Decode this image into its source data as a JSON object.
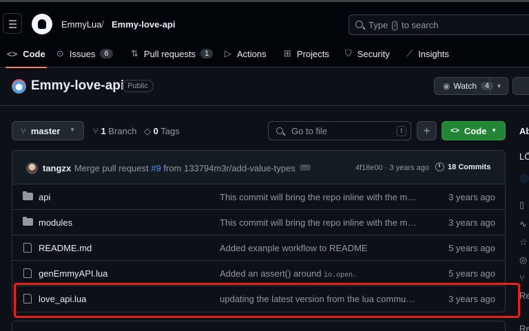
{
  "header": {
    "owner": "EmmyLua",
    "separator": "/",
    "repo": "Emmy-love-api",
    "search_placeholder_pre": "Type",
    "search_key": "/",
    "search_placeholder_post": "to search"
  },
  "tabs": [
    {
      "label": "Code",
      "icon": "code-icon",
      "active": true
    },
    {
      "label": "Issues",
      "icon": "issue-icon",
      "count": "6"
    },
    {
      "label": "Pull requests",
      "icon": "pull-request-icon",
      "count": "1"
    },
    {
      "label": "Actions",
      "icon": "play-icon"
    },
    {
      "label": "Projects",
      "icon": "table-icon"
    },
    {
      "label": "Security",
      "icon": "shield-icon"
    },
    {
      "label": "Insights",
      "icon": "graph-icon"
    }
  ],
  "repo_header": {
    "name": "Emmy-love-api",
    "visibility": "Public",
    "watch_label": "Watch",
    "watch_count": "4"
  },
  "toolbar": {
    "branch": "master",
    "branches_count": "1",
    "branches_label": "Branch",
    "tags_count": "0",
    "tags_label": "Tags",
    "gofile_placeholder": "Go to file",
    "gofile_key": "t",
    "add_label": "+",
    "code_label": "Code"
  },
  "sidebar_fragments": [
    "Ab",
    "LÖ",
    "Re",
    "Re"
  ],
  "latest_commit": {
    "author": "tangzx",
    "message_pre": "Merge pull request",
    "pr": "#9",
    "message_post": "from 133794m3r/add-value-types",
    "hash": "4f18e00",
    "age": "3 years ago",
    "commits_count": "18",
    "commits_label": "Commits"
  },
  "files": [
    {
      "type": "folder",
      "name": "api",
      "message": "This commit will bring the repo inline with the main lua community api",
      "date": "3 years ago"
    },
    {
      "type": "folder",
      "name": "modules",
      "message": "This commit will bring the repo inline with the main lua community api",
      "date": "3 years ago"
    },
    {
      "type": "file",
      "name": "README.md",
      "message": "Added exanple workflow to README",
      "date": "5 years ago"
    },
    {
      "type": "file",
      "name": "genEmmyAPI.lua",
      "message_pre": "Added an assert() around",
      "message_code": "io.open.",
      "date": "5 years ago"
    },
    {
      "type": "file",
      "name": "love_api.lua",
      "message": "updating the latest version from the lua community api",
      "date": "3 years ago"
    }
  ],
  "colors": {
    "background": "#0d1117",
    "accent_tab": "#f78166",
    "code_button": "#238636",
    "highlight_box": "#e8221a",
    "link": "#4493f8"
  }
}
